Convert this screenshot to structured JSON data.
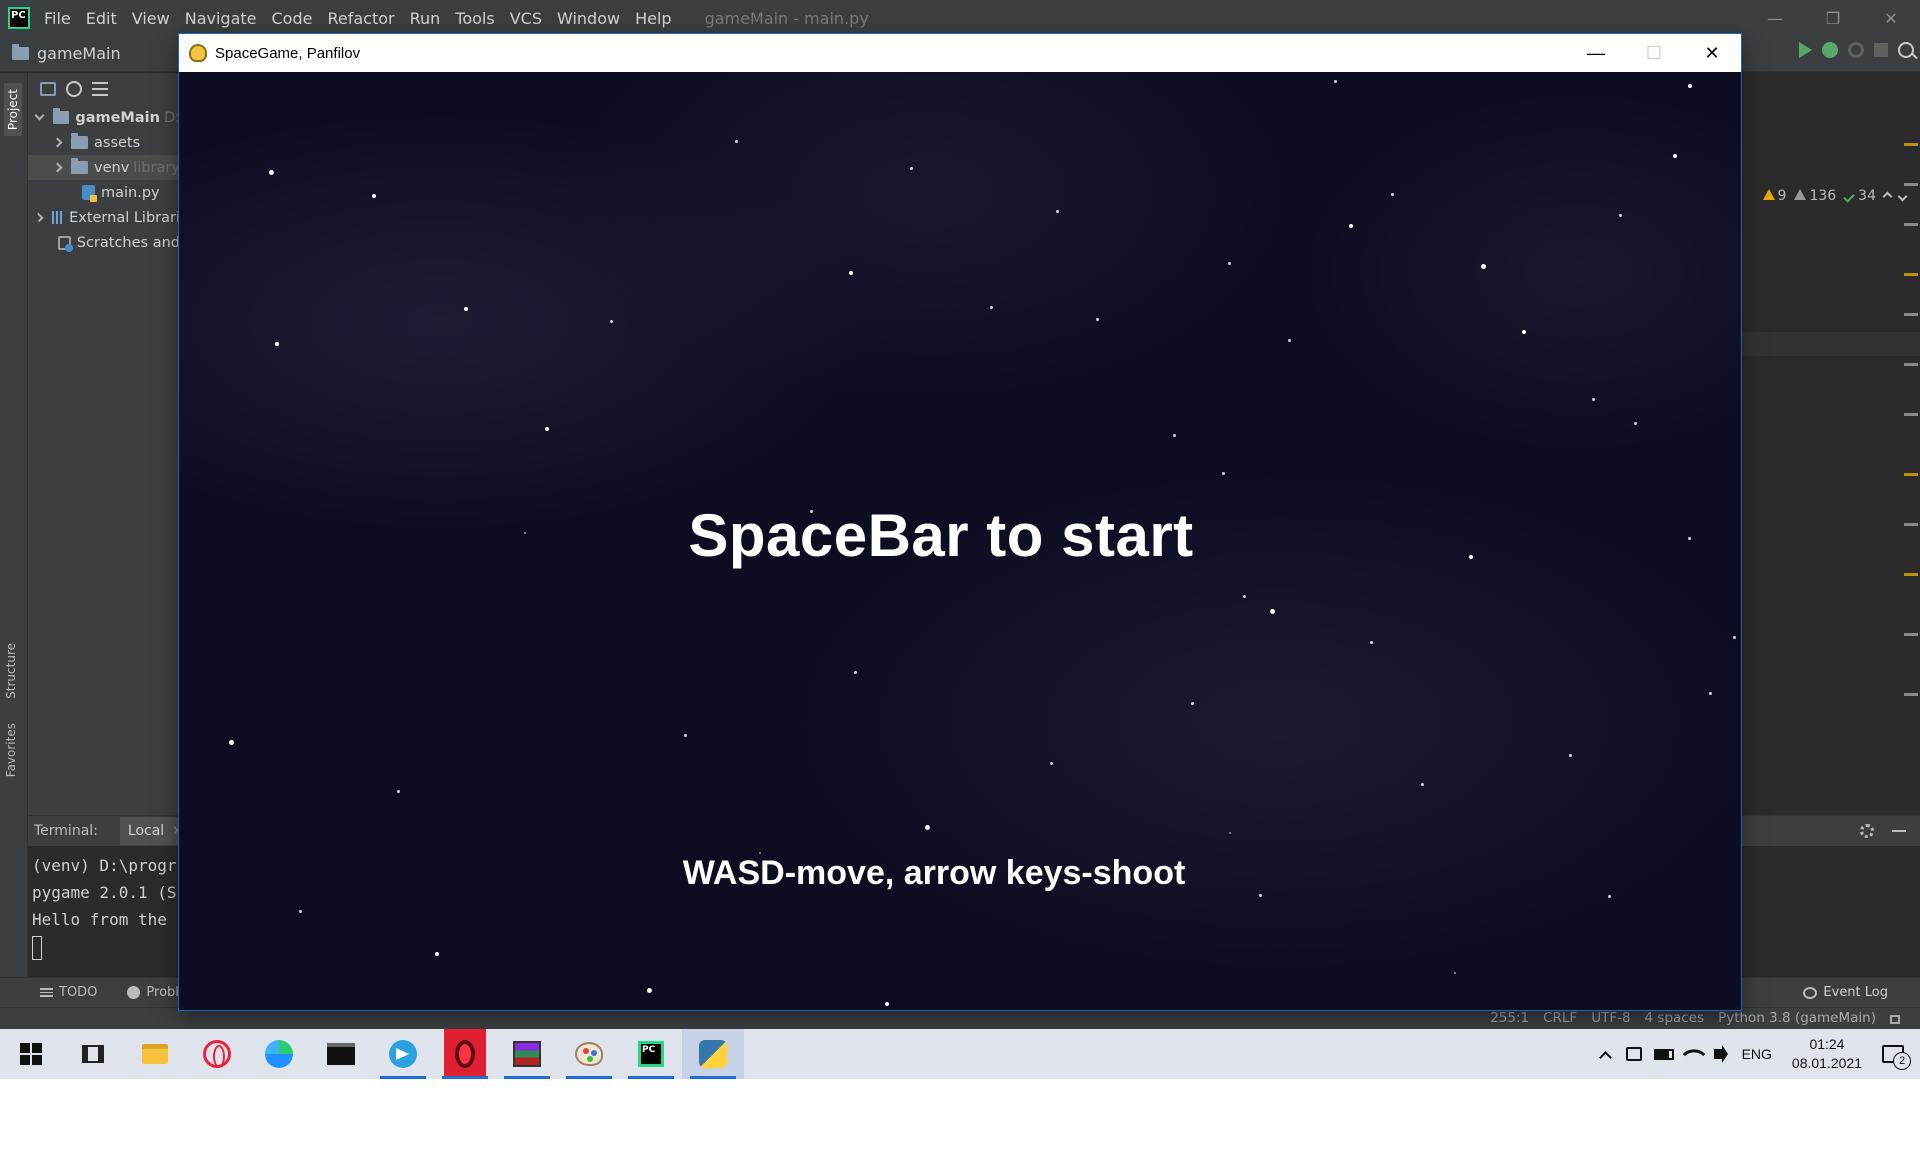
{
  "ide": {
    "menu": [
      "File",
      "Edit",
      "View",
      "Navigate",
      "Code",
      "Refactor",
      "Run",
      "Tools",
      "VCS",
      "Window",
      "Help"
    ],
    "window_title": "gameMain - main.py",
    "breadcrumb": "gameMain",
    "side_tabs": {
      "project": "Project",
      "structure": "Structure",
      "favorites": "Favorites"
    },
    "tree": {
      "root": "gameMain",
      "root_path": "D:",
      "assets": "assets",
      "venv": "venv",
      "venv_note": "library",
      "main_py": "main.py",
      "external": "External Librari",
      "scratches": "Scratches and"
    },
    "inspections": {
      "warnings": "9",
      "weak_warnings": "136",
      "typos": "34"
    },
    "terminal": {
      "title": "Terminal:",
      "tab": "Local",
      "lines": [
        "(venv) D:\\progr",
        "pygame 2.0.1 (S",
        "Hello from the "
      ]
    },
    "bottom_tabs": {
      "todo": "TODO",
      "problems": "Proble",
      "event_log": "Event Log"
    },
    "status": {
      "position": "255:1",
      "line_sep": "CRLF",
      "encoding": "UTF-8",
      "indent": "4 spaces",
      "interpreter": "Python 3.8 (gameMain)"
    }
  },
  "game": {
    "window_title": "SpaceGame, Panfilov",
    "start_text": "SpaceBar to start",
    "controls_text": "WASD-move, arrow keys-shoot",
    "colors": {
      "background": "#0d0d22",
      "text": "#ffffff",
      "stars": "#ffffff"
    }
  },
  "taskbar": {
    "apps": [
      "start-icon",
      "task-view-icon",
      "file-explorer-icon",
      "opera-gx-icon",
      "edge-icon",
      "terminal-icon",
      "telegram-icon",
      "opera-icon",
      "winrar-icon",
      "paint-icon",
      "pycharm-icon",
      "python-icon"
    ],
    "language": "ENG",
    "time": "01:24",
    "date": "08.01.2021",
    "notification_count": "2"
  }
}
